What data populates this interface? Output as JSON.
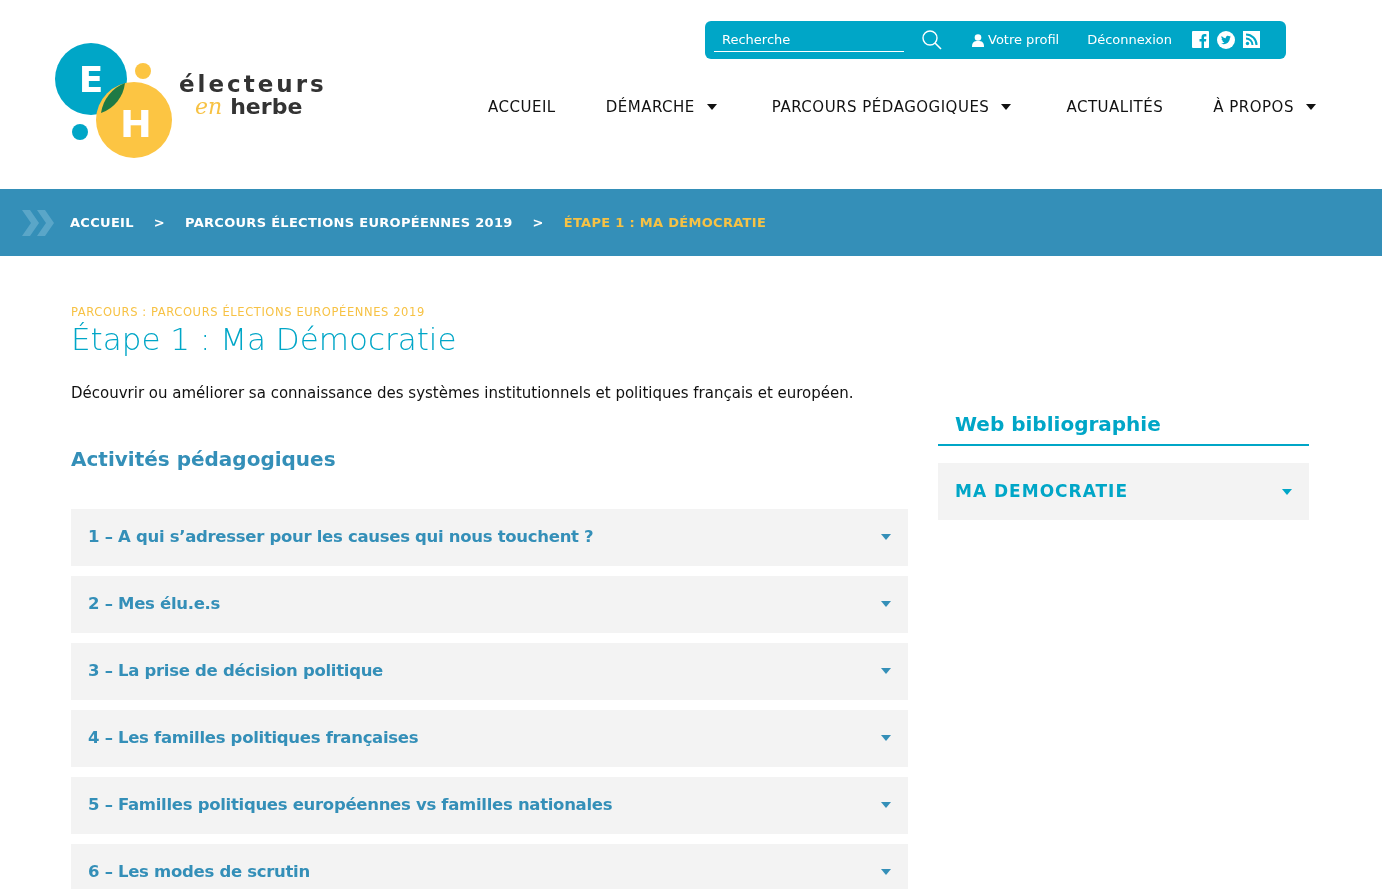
{
  "logo": {
    "letter_1": "E",
    "letter_2": "H",
    "word_1": "électeurs",
    "word_2": "en",
    "word_3": "herbe"
  },
  "top_bar": {
    "search": {
      "placeholder": "Recherche"
    },
    "profile": "Votre profil",
    "logout": "Déconnexion"
  },
  "nav": [
    {
      "label": "ACCUEIL",
      "dropdown": false
    },
    {
      "label": "DÉMARCHE",
      "dropdown": true
    },
    {
      "label": "PARCOURS PÉDAGOGIQUES",
      "dropdown": true
    },
    {
      "label": "ACTUALITÉS",
      "dropdown": false
    },
    {
      "label": "À PROPOS",
      "dropdown": true
    }
  ],
  "breadcrumb": [
    {
      "label": "ACCUEIL",
      "current": false
    },
    {
      "label": "PARCOURS ÉLECTIONS EUROPÉENNES 2019",
      "current": false
    },
    {
      "label": "ÉTAPE 1 : MA DÉMOCRATIE",
      "current": true
    }
  ],
  "breadcrumb_separator": ">",
  "page": {
    "kicker": "PARCOURS : PARCOURS ÉLECTIONS EUROPÉENNES 2019",
    "title": "Étape 1 : Ma Démocratie",
    "intro": "Découvrir ou améliorer sa connaissance des systèmes institutionnels et politiques français et européen.",
    "section_title": "Activités pédagogiques"
  },
  "activities": [
    {
      "label": "1 – A qui s’adresser pour les causes qui nous touchent ?",
      "expanded": false
    },
    {
      "label": "2 – Mes élu.e.s",
      "expanded": false
    },
    {
      "label": "3 – La prise de décision politique",
      "expanded": false
    },
    {
      "label": "4 – Les familles politiques françaises",
      "expanded": false
    },
    {
      "label": "5 – Familles politiques européennes vs familles nationales",
      "expanded": false
    },
    {
      "label": "6 – Les modes de scrutin",
      "expanded": false
    }
  ],
  "sidebar": {
    "title": "Web bibliographie",
    "items": [
      {
        "label": "MA DEMOCRATIE",
        "expanded": false
      }
    ]
  }
}
